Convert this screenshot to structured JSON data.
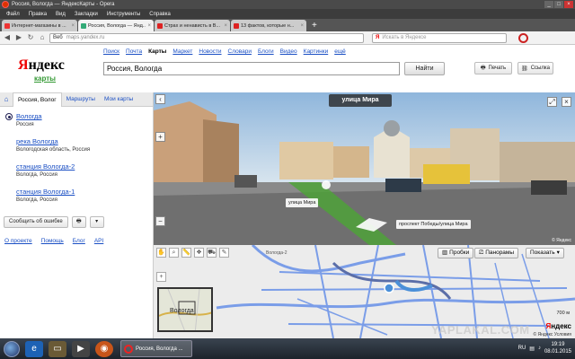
{
  "window": {
    "title": "Россия, Вологда — ЯндексКарты - Opera",
    "buttons": [
      "_",
      "□",
      "×"
    ]
  },
  "menu": [
    "Файл",
    "Правка",
    "Вид",
    "Закладки",
    "Инструменты",
    "Справка"
  ],
  "tabs": [
    {
      "label": "Интернет-магазины в ...",
      "color": "#e33",
      "active": false
    },
    {
      "label": "Россия, Вологда — Янд...",
      "color": "#3a7",
      "active": true
    },
    {
      "label": "Страх и ненависть в В...",
      "color": "#d22",
      "active": false
    },
    {
      "label": "13 фактов, которые н...",
      "color": "#d22",
      "active": false
    }
  ],
  "newtab": "+",
  "address": {
    "web_label": "Веб",
    "url": "maps.yandex.ru"
  },
  "search": {
    "placeholder": "Искать в Яндексе"
  },
  "yandex": {
    "logo_main": "ндекс",
    "logo_first": "Я",
    "subtitle": "карты",
    "services": [
      {
        "label": "Поиск",
        "current": false
      },
      {
        "label": "Почта",
        "current": false
      },
      {
        "label": "Карты",
        "current": true
      },
      {
        "label": "Маркет",
        "current": false
      },
      {
        "label": "Новости",
        "current": false
      },
      {
        "label": "Словари",
        "current": false
      },
      {
        "label": "Блоги",
        "current": false
      },
      {
        "label": "Видео",
        "current": false
      },
      {
        "label": "Картинки",
        "current": false
      },
      {
        "label": "ещё",
        "current": false
      }
    ],
    "query": "Россия, Вологда",
    "find_label": "Найти",
    "print_label": "Печать",
    "link_label": "Ссылка"
  },
  "sidebar": {
    "tabs": [
      "Россия, Волог",
      "Маршруты",
      "Мои карты"
    ],
    "results": [
      {
        "name": "Вологда",
        "sub": "Россия",
        "selected": true
      },
      {
        "name": "река Вологда",
        "sub": "Вологодская область, Россия",
        "selected": false
      },
      {
        "name": "станция Вологда-2",
        "sub": "Вологда, Россия",
        "selected": false
      },
      {
        "name": "станция Вологда-1",
        "sub": "Вологда, Россия",
        "selected": false
      }
    ],
    "report_label": "Сообщить об ошибке",
    "footer": [
      "О проекте",
      "Помощь",
      "Блог",
      "API"
    ]
  },
  "panorama": {
    "street": "улица Мира",
    "tag_left": "улица Мира",
    "tag_right": "проспект Победы/улица Мира",
    "copyright": "© Яндекс"
  },
  "map": {
    "traffic_label": "Пробки",
    "panorama_label": "Панорамы",
    "show_label": "Показать",
    "minimap_label": "Вологда",
    "district_label": "Вологда-2",
    "scale": "700 м",
    "copyright": "© Яндекс  Условия",
    "logo_first": "Я",
    "logo_main": "ндекс"
  },
  "taskbar": {
    "task_label": "Россия, Вологда ...",
    "lang": "RU",
    "time": "19:19",
    "date": "08.01.2015"
  },
  "watermark": "YAPLAKAL.COM"
}
